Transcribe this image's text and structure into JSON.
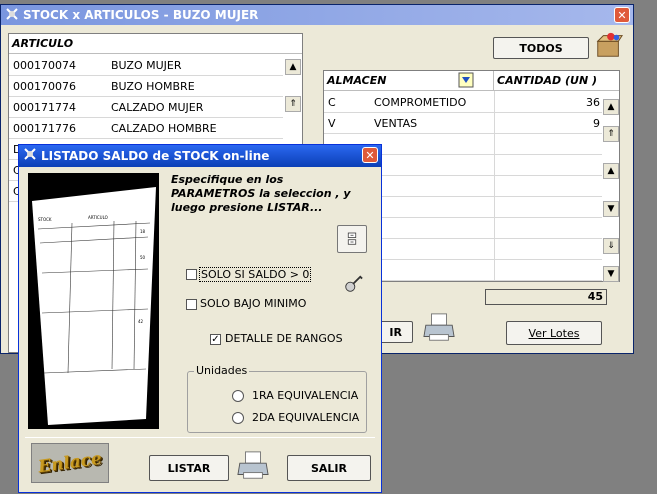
{
  "stock_window": {
    "title": "STOCK x ARTICULOS - BUZO MUJER",
    "close_glyph": "✕",
    "articulo_header": "ARTICULO",
    "articulos": [
      {
        "code": "000170074",
        "name": "BUZO MUJER"
      },
      {
        "code": "000170076",
        "name": "BUZO HOMBRE"
      },
      {
        "code": "000171774",
        "name": "CALZADO MUJER"
      },
      {
        "code": "000171776",
        "name": "CALZADO HOMBRE"
      }
    ],
    "partial_codes": [
      "D",
      "C",
      "C"
    ],
    "todos_label": "TODOS",
    "almacen_header": "ALMACEN",
    "cantidad_header": "CANTIDAD (UN  )",
    "almacenes": [
      {
        "code": "C",
        "name": "COMPROMETIDO",
        "qty": "36"
      },
      {
        "code": "V",
        "name": "VENTAS",
        "qty": "9"
      }
    ],
    "total": "45",
    "partial_button": "IR",
    "ver_lotes_label": "Ver Lotes"
  },
  "listado_dialog": {
    "title": "LISTADO SALDO de STOCK on-line",
    "close_glyph": "✕",
    "instructions": "Especifique en los PARAMETROS la seleccion , y luego presione LISTAR...",
    "solo_saldo_label": "SOLO SI SALDO > 0",
    "solo_saldo_checked": false,
    "solo_bajo_label": "SOLO BAJO MINIMO",
    "solo_bajo_checked": false,
    "detalle_label": "DETALLE DE RANGOS",
    "detalle_checked": true,
    "check_mark": "✓",
    "unidades_legend": "Unidades",
    "eq1_label": "1RA EQUIVALENCIA",
    "eq2_label": "2DA EQUIVALENCIA",
    "listar_label": "LISTAR",
    "salir_label": "SALIR",
    "logo_text": "Enlace",
    "preview": {
      "title": "STOCK",
      "col": "ARTICULO",
      "nums": [
        "18",
        "50",
        "42"
      ]
    }
  },
  "colors": {
    "title_active": "#0b3fb6",
    "title_inactive": "#7a96df",
    "window_bg": "#ece9d8",
    "desktop": "#808080"
  }
}
